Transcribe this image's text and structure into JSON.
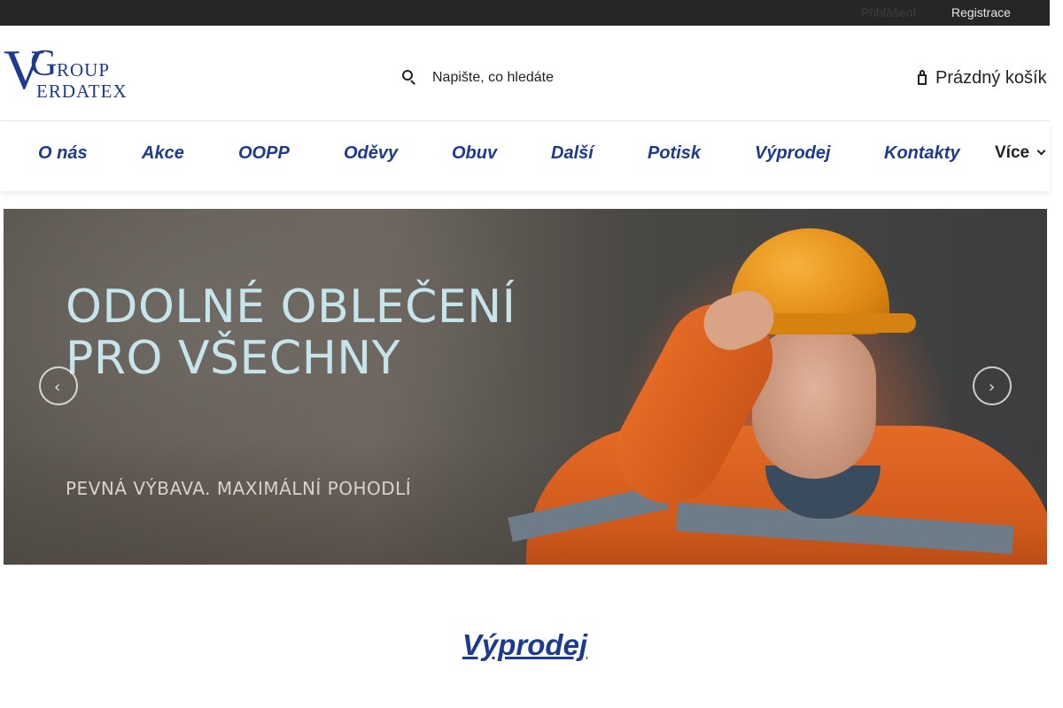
{
  "topbar": {
    "login": "Přihlášení",
    "register": "Registrace"
  },
  "header": {
    "logo": {
      "letter_v": "V",
      "letter_g": "G",
      "word_group": "ROUP",
      "word_verdatex": "ERDATEX"
    },
    "search": {
      "icon": "search-icon",
      "placeholder": "Napište, co hledáte"
    },
    "cart": {
      "icon": "shopping-bag-icon",
      "label": "Prázdný košík"
    }
  },
  "nav": {
    "items": [
      {
        "label": "O nás"
      },
      {
        "label": "Akce"
      },
      {
        "label": "OOPP"
      },
      {
        "label": "Oděvy"
      },
      {
        "label": "Obuv"
      },
      {
        "label": "Další"
      },
      {
        "label": "Potisk"
      },
      {
        "label": "Výprodej"
      },
      {
        "label": "Kontakty"
      }
    ],
    "more_label": "Více"
  },
  "banner": {
    "headline_line1": "ODOLNÉ OBLEČENÍ",
    "headline_line2": "PRO VŠECHNY",
    "subline": "PEVNÁ VÝBAVA. MAXIMÁLNÍ POHODLÍ",
    "prev_icon": "chevron-left-icon",
    "next_icon": "chevron-right-icon",
    "prev_glyph": "‹",
    "next_glyph": "›"
  },
  "section": {
    "title": "Výprodej"
  },
  "colors": {
    "brand_blue": "#1c3a8f",
    "topbar_bg": "#262626"
  }
}
